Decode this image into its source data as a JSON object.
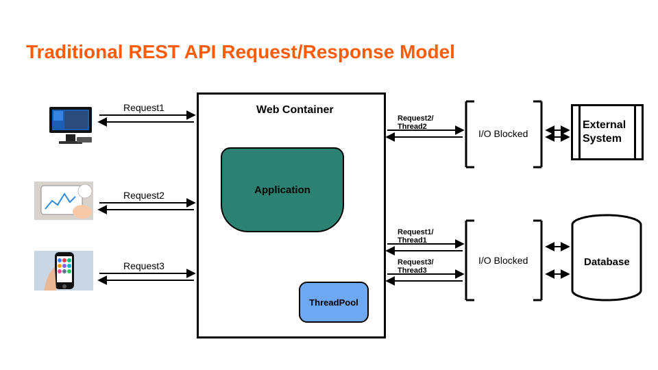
{
  "title": "Traditional REST API Request/Response Model",
  "clients": {
    "req1": "Request1",
    "req2": "Request2",
    "req3": "Request3"
  },
  "container": {
    "title": "Web Container",
    "application": "Application",
    "threadpool": "ThreadPool"
  },
  "outbound": {
    "top": "Request2/\nThread2",
    "mid": "Request1/\nThread1",
    "bot": "Request3/\nThread3",
    "io_top": "I/O Blocked",
    "io_bot": "I/O Blocked"
  },
  "systems": {
    "external": "External System",
    "database": "Database"
  }
}
